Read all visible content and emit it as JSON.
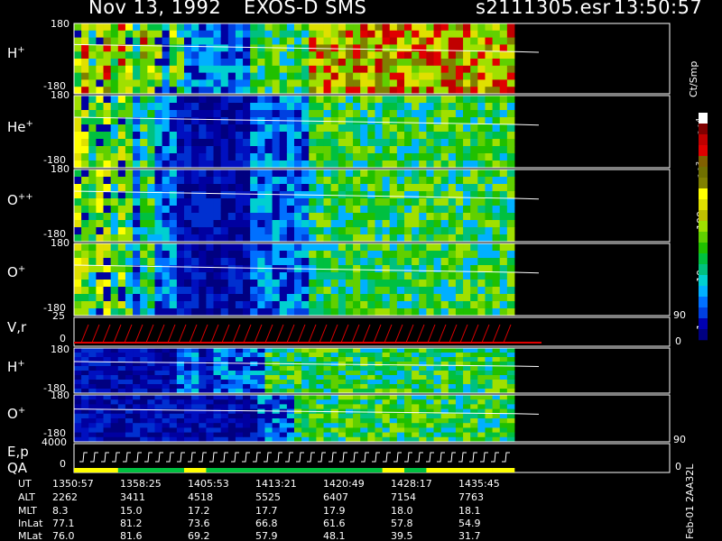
{
  "header": {
    "date": "Nov 13, 1992",
    "instrument": "EXOS-D SMS",
    "file": "s2111305.esr",
    "time": "13:50:57"
  },
  "chart_data": {
    "type": "heatmap",
    "panels": [
      {
        "id": "H+",
        "species": "H",
        "charge": "+",
        "ymax": "180",
        "ymin": "-180",
        "intensity": [
          4,
          5,
          3,
          4,
          5,
          3,
          5,
          4,
          3,
          5,
          4,
          4,
          2,
          4,
          3,
          2,
          2,
          2,
          2,
          2,
          2,
          2,
          2,
          2,
          3,
          3,
          3,
          3,
          3,
          3,
          3,
          3,
          5,
          5,
          5,
          5,
          5,
          5,
          5,
          5,
          5,
          5,
          5,
          5,
          5,
          5,
          5,
          5,
          5,
          5,
          5,
          5,
          5,
          5,
          5,
          5,
          5,
          5,
          5,
          5
        ]
      },
      {
        "id": "He+",
        "species": "He",
        "charge": "+",
        "ymax": "180",
        "ymin": "-180",
        "intensity": [
          4,
          4,
          3,
          4,
          4,
          3,
          4,
          3,
          2,
          3,
          3,
          2,
          2,
          2,
          1,
          1,
          1,
          1,
          1,
          1,
          1,
          1,
          1,
          1,
          2,
          2,
          2,
          2,
          2,
          2,
          2,
          2,
          3,
          3,
          3,
          3,
          3,
          3,
          3,
          3,
          3,
          3,
          3,
          3,
          3,
          3,
          3,
          3,
          3,
          3,
          3,
          3,
          3,
          3,
          3,
          3,
          3,
          3,
          3,
          3
        ]
      },
      {
        "id": "O++",
        "species": "O",
        "charge": "++",
        "ymax": "180",
        "ymin": "-180",
        "intensity": [
          4,
          4,
          3,
          4,
          4,
          3,
          4,
          3,
          2,
          3,
          3,
          2,
          2,
          2,
          1,
          1,
          1,
          1,
          1,
          1,
          1,
          1,
          1,
          1,
          2,
          2,
          2,
          2,
          2,
          2,
          2,
          2,
          3,
          3,
          3,
          3,
          3,
          3,
          3,
          3,
          3,
          3,
          3,
          3,
          3,
          3,
          3,
          3,
          3,
          3,
          3,
          3,
          3,
          3,
          3,
          3,
          3,
          3,
          3,
          3
        ]
      },
      {
        "id": "O+",
        "species": "O",
        "charge": "+",
        "ymax": "180",
        "ymin": "-180",
        "intensity": [
          4,
          4,
          3,
          4,
          4,
          3,
          4,
          3,
          2,
          3,
          3,
          2,
          2,
          2,
          1,
          1,
          1,
          1,
          1,
          1,
          1,
          1,
          1,
          1,
          2,
          2,
          2,
          2,
          2,
          2,
          2,
          2,
          3,
          3,
          3,
          3,
          3,
          3,
          3,
          3,
          3,
          3,
          3,
          3,
          3,
          3,
          3,
          3,
          3,
          3,
          3,
          3,
          3,
          3,
          3,
          3,
          3,
          3,
          3,
          3
        ]
      },
      {
        "id": "H+ (2)",
        "species": "H",
        "charge": "+",
        "ymax": "180",
        "ymin": "-180",
        "intensity": [
          1,
          1,
          1,
          1,
          1,
          1,
          1,
          1,
          1,
          1,
          1,
          1,
          1,
          1,
          2,
          2,
          2,
          1,
          1,
          2,
          2,
          2,
          2,
          2,
          2,
          2,
          3,
          3,
          3,
          3,
          3,
          3,
          3,
          3,
          3,
          3,
          3,
          3,
          3,
          3,
          3,
          3,
          3,
          3,
          3,
          3,
          3,
          3,
          3,
          3,
          3,
          3,
          3,
          3,
          3,
          3,
          3,
          3,
          3,
          3
        ]
      },
      {
        "id": "O+ (2)",
        "species": "O",
        "charge": "+",
        "ymax": "180",
        "ymin": "-180",
        "intensity": [
          1,
          1,
          1,
          1,
          1,
          1,
          1,
          1,
          1,
          1,
          1,
          1,
          1,
          1,
          1,
          1,
          1,
          1,
          1,
          1,
          1,
          1,
          1,
          1,
          1,
          2,
          2,
          2,
          2,
          2,
          3,
          3,
          3,
          3,
          3,
          3,
          3,
          3,
          3,
          3,
          3,
          3,
          3,
          3,
          3,
          3,
          3,
          3,
          3,
          3,
          3,
          3,
          3,
          3,
          3,
          3,
          3,
          3,
          3,
          3
        ]
      }
    ],
    "vr_panel": {
      "label": "V,r",
      "ymax_left": "25",
      "ymin_left": "0",
      "ymax_right": "90",
      "ymin_right": "0"
    },
    "ep_panel": {
      "label1": "E,p",
      "label2": "QA",
      "ymax_left": "4000",
      "ymin_left": "0",
      "ymax_right": "90",
      "ymin_right": "0"
    },
    "colorbar": {
      "unit": "Ct/Smp",
      "tick_labels": [
        {
          "base": "10",
          "exp": "4"
        },
        {
          "base": "10",
          "exp": "3"
        },
        {
          "base": "100",
          "exp": ""
        },
        {
          "base": "10",
          "exp": ""
        },
        {
          "base": "1",
          "exp": ""
        }
      ],
      "colors": [
        "#000080",
        "#0000b0",
        "#0040e0",
        "#0070ff",
        "#00b0ff",
        "#00d0d0",
        "#00c080",
        "#00c040",
        "#20c000",
        "#60d000",
        "#a0e000",
        "#c0c000",
        "#e0e000",
        "#ffff00",
        "#808000",
        "#707000",
        "#806000",
        "#e00000",
        "#c00000",
        "#800000",
        "#ffffff"
      ]
    },
    "time_axis": {
      "labels": [
        "UT",
        "ALT",
        "MLT",
        "InLat",
        "MLat"
      ],
      "columns": [
        {
          "UT": "1350:57",
          "ALT": "2262",
          "MLT": "8.3",
          "InLat": "77.1",
          "MLat": "76.0"
        },
        {
          "UT": "1358:25",
          "ALT": "3411",
          "MLT": "15.0",
          "InLat": "81.2",
          "MLat": "81.6"
        },
        {
          "UT": "1405:53",
          "ALT": "4518",
          "MLT": "17.2",
          "InLat": "73.6",
          "MLat": "69.2"
        },
        {
          "UT": "1413:21",
          "ALT": "5525",
          "MLT": "17.7",
          "InLat": "66.8",
          "MLat": "57.9"
        },
        {
          "UT": "1420:49",
          "ALT": "6407",
          "MLT": "17.9",
          "InLat": "61.6",
          "MLat": "48.1"
        },
        {
          "UT": "1428:17",
          "ALT": "7154",
          "MLT": "18.0",
          "InLat": "57.8",
          "MLat": "39.5"
        },
        {
          "UT": "1435:45",
          "ALT": "7763",
          "MLT": "18.1",
          "InLat": "54.9",
          "MLat": "31.7"
        }
      ]
    }
  },
  "footer": {
    "side_text": "Feb-01 2AA32L"
  }
}
